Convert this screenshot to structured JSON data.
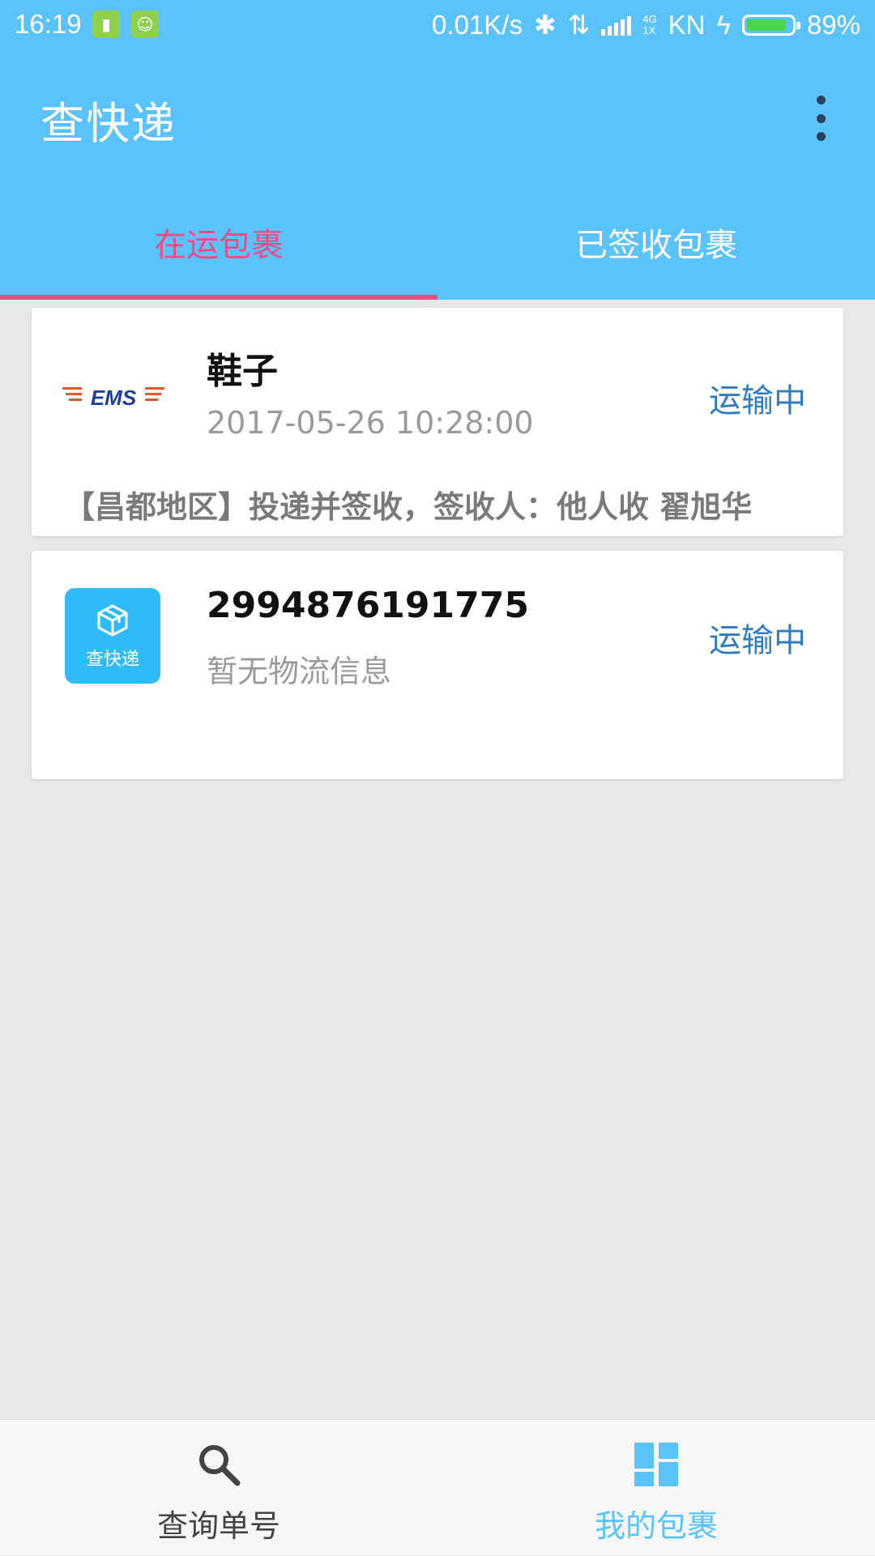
{
  "status_bar": {
    "time": "16:19",
    "network_speed": "0.01K/s",
    "net_type_top": "4G",
    "net_type_bottom": "1X",
    "carrier": "KN",
    "battery_percent": "89%",
    "battery_level": 0.89,
    "icons": [
      "battery-app-icon",
      "android-app-icon",
      "bluetooth-icon",
      "data-arrows-icon",
      "signal-icon",
      "charging-icon",
      "battery-icon"
    ]
  },
  "app_bar": {
    "title": "查快递",
    "menu_icon": "more-vert-icon"
  },
  "tabs": [
    {
      "label": "在运包裹",
      "active": true
    },
    {
      "label": "已签收包裹",
      "active": false
    }
  ],
  "packages": [
    {
      "logo": "EMS",
      "title": "鞋子",
      "subtitle": "2017-05-26 10:28:00",
      "status": "运输中",
      "detail": "【昌都地区】投递并签收，签收人：他人收 翟旭华"
    },
    {
      "logo_text": "查快递",
      "logo_icon": "package-box-icon",
      "title": "2994876191775",
      "subtitle": "暂无物流信息",
      "status": "运输中"
    }
  ],
  "bottom_nav": [
    {
      "label": "查询单号",
      "icon": "search-icon",
      "active": false
    },
    {
      "label": "我的包裹",
      "icon": "dashboard-icon",
      "active": true
    }
  ],
  "colors": {
    "primary": "#5bc3fb",
    "accent": "#ef4b86",
    "status_text": "#2f7ec3",
    "background": "#e8e8e8"
  }
}
